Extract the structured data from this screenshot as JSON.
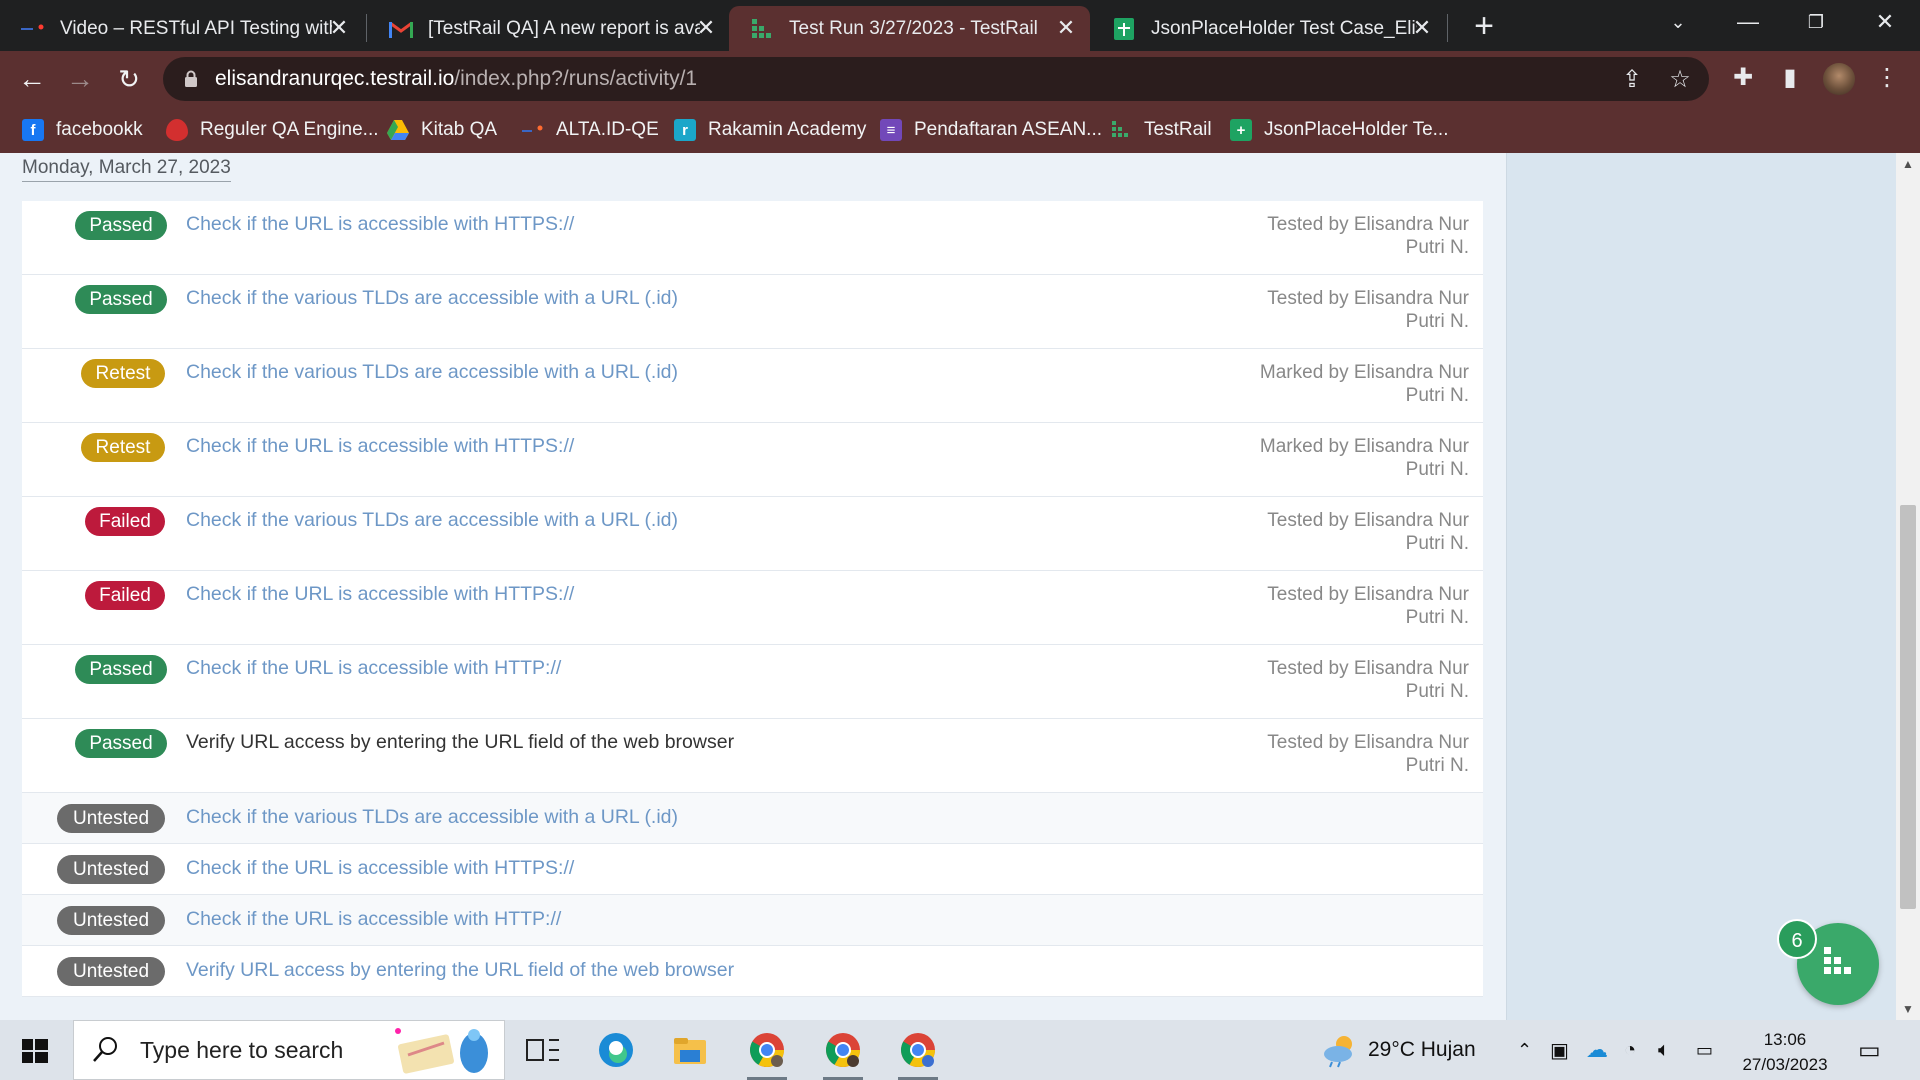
{
  "browser": {
    "tabs": [
      {
        "title": "Video – RESTful API Testing with I",
        "active": false
      },
      {
        "title": "[TestRail QA] A new report is avai",
        "active": false
      },
      {
        "title": "Test Run 3/27/2023 - TestRail",
        "active": true
      },
      {
        "title": "JsonPlaceHolder Test Case_Elisan",
        "active": false
      }
    ],
    "url_host": "elisandranurqec.testrail.io",
    "url_path": "/index.php?/runs/activity/1",
    "bookmarks": [
      {
        "label": "facebookk"
      },
      {
        "label": "Reguler QA Engine..."
      },
      {
        "label": "Kitab QA"
      },
      {
        "label": "ALTA.ID-QE"
      },
      {
        "label": "Rakamin Academy"
      },
      {
        "label": "Pendaftaran ASEAN..."
      },
      {
        "label": "TestRail"
      },
      {
        "label": "JsonPlaceHolder Te..."
      }
    ]
  },
  "page": {
    "date_heading": "Monday, March 27, 2023",
    "activities": [
      {
        "status": "Passed",
        "title": "Check if the URL is accessible with HTTPS://",
        "by_line1": "Tested by Elisandra Nur",
        "by_line2": "Putri N."
      },
      {
        "status": "Passed",
        "title": "Check if the various TLDs are accessible with a URL (.id)",
        "by_line1": "Tested by Elisandra Nur",
        "by_line2": "Putri N."
      },
      {
        "status": "Retest",
        "title": "Check if the various TLDs are accessible with a URL (.id)",
        "by_line1": "Marked by Elisandra Nur",
        "by_line2": "Putri N."
      },
      {
        "status": "Retest",
        "title": "Check if the URL is accessible with HTTPS://",
        "by_line1": "Marked by Elisandra Nur",
        "by_line2": "Putri N."
      },
      {
        "status": "Failed",
        "title": "Check if the various TLDs are accessible with a URL (.id)",
        "by_line1": "Tested by Elisandra Nur",
        "by_line2": "Putri N."
      },
      {
        "status": "Failed",
        "title": "Check if the URL is accessible with HTTPS://",
        "by_line1": "Tested by Elisandra Nur",
        "by_line2": "Putri N."
      },
      {
        "status": "Passed",
        "title": "Check if the URL is accessible with HTTP://",
        "by_line1": "Tested by Elisandra Nur",
        "by_line2": "Putri N."
      },
      {
        "status": "Passed",
        "title": "Verify URL access by entering the URL field of the web browser",
        "by_line1": "Tested by Elisandra Nur",
        "by_line2": "Putri N."
      },
      {
        "status": "Untested",
        "title": "Check if the various TLDs are accessible with a URL (.id)"
      },
      {
        "status": "Untested",
        "title": "Check if the URL is accessible with HTTPS://"
      },
      {
        "status": "Untested",
        "title": "Check if the URL is accessible with HTTP://"
      },
      {
        "status": "Untested",
        "title": "Verify URL access by entering the URL field of the web browser"
      }
    ],
    "fab_count": "6"
  },
  "taskbar": {
    "search_placeholder": "Type here to search",
    "weather": "29°C  Hujan",
    "time": "13:06",
    "date": "27/03/2023"
  },
  "colors": {
    "passed": "#2e8b57",
    "retest": "#c89a12",
    "failed": "#bd1a3c",
    "untested": "#6b6b6b",
    "link": "#6d97c6",
    "chrome_theme": "#5b3030"
  },
  "icons": [
    "youtube-icon",
    "gmail-icon",
    "testrail-icon",
    "sheets-icon",
    "lock-icon",
    "share-icon",
    "star-icon",
    "extensions-icon",
    "sidepanel-icon",
    "menu-icon",
    "facebook-icon",
    "windows-icon",
    "search-icon",
    "edge-icon",
    "chrome-icon",
    "folder-icon"
  ]
}
